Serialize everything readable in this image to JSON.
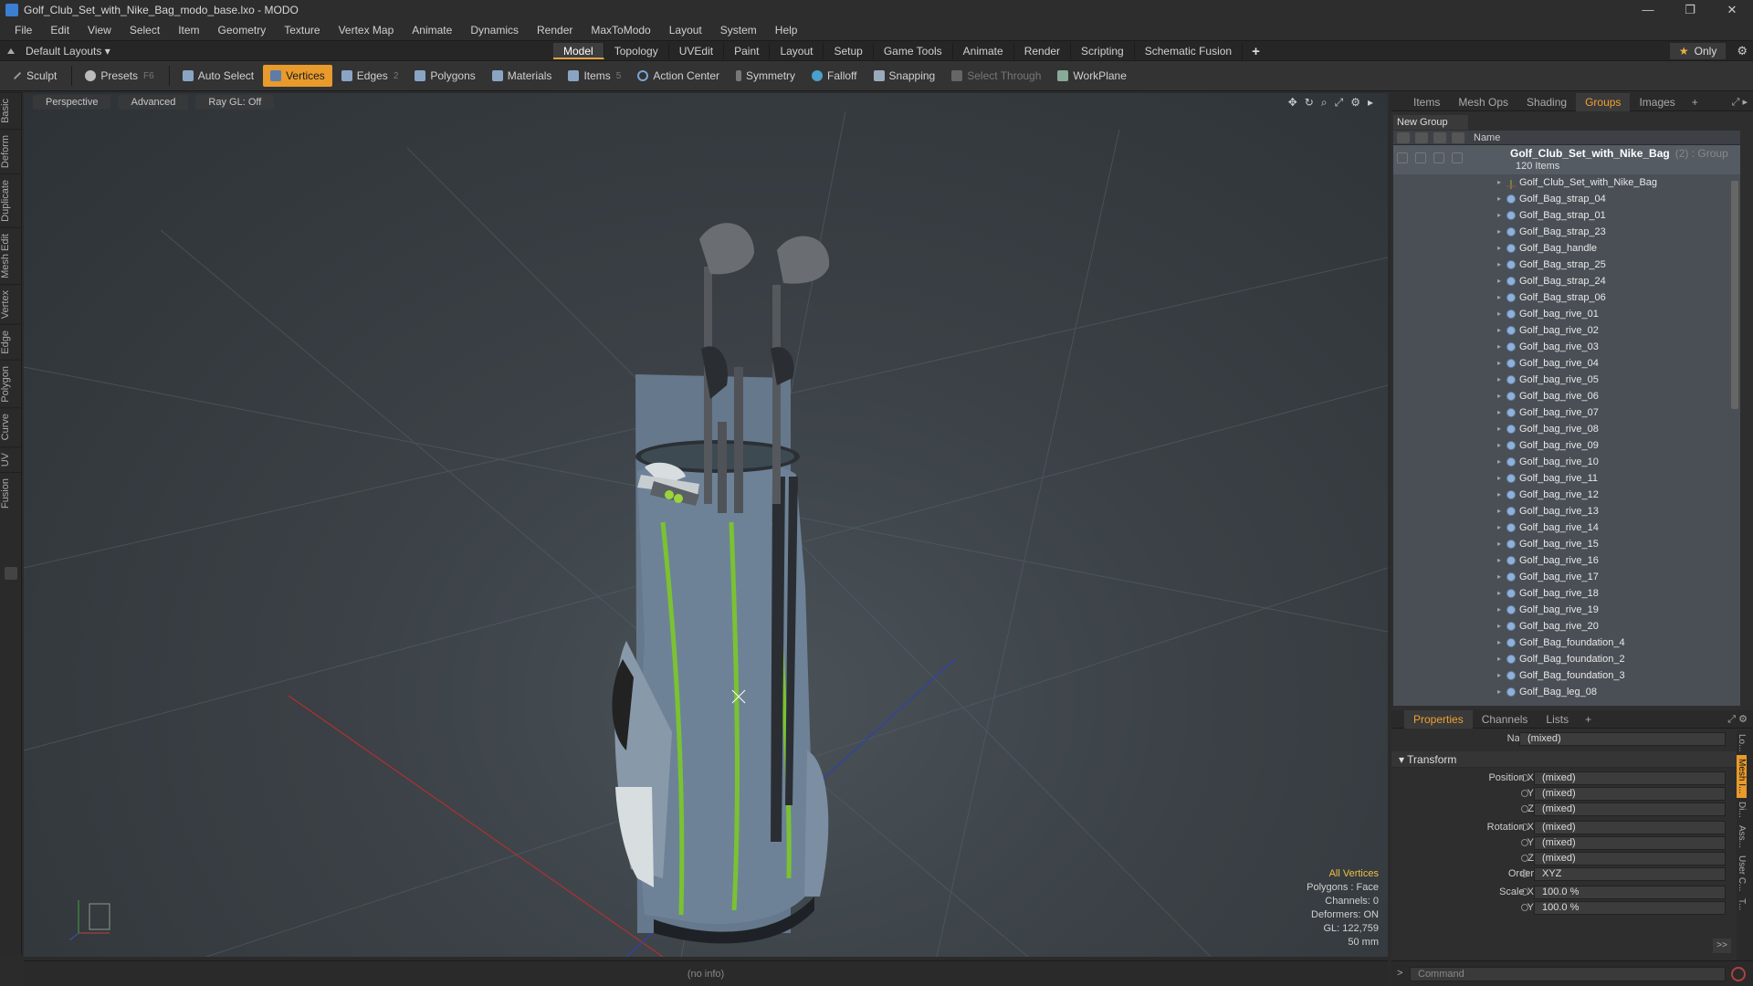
{
  "window": {
    "title": "Golf_Club_Set_with_Nike_Bag_modo_base.lxo - MODO",
    "controls": [
      "—",
      "❐",
      "✕"
    ]
  },
  "menu": [
    "File",
    "Edit",
    "View",
    "Select",
    "Item",
    "Geometry",
    "Texture",
    "Vertex Map",
    "Animate",
    "Dynamics",
    "Render",
    "MaxToModo",
    "Layout",
    "System",
    "Help"
  ],
  "layoutbar": {
    "layout_select": "Default Layouts ▾",
    "tabs": [
      "Model",
      "Topology",
      "UVEdit",
      "Paint",
      "Layout",
      "Setup",
      "Game Tools",
      "Animate",
      "Render",
      "Scripting",
      "Schematic Fusion"
    ],
    "active_tab": "Model",
    "add": "+",
    "only_label": "Only",
    "star": "★",
    "gear": "⚙"
  },
  "toolbar": {
    "sculpt": "Sculpt",
    "presets": "Presets",
    "presets_key": "F6",
    "auto_select": "Auto Select",
    "vertices": "Vertices",
    "edges": "Edges",
    "edges_key": "2",
    "polygons": "Polygons",
    "materials": "Materials",
    "items": "Items",
    "items_key": "5",
    "action_center": "Action Center",
    "symmetry": "Symmetry",
    "falloff": "Falloff",
    "snapping": "Snapping",
    "select_through": "Select Through",
    "workplane": "WorkPlane"
  },
  "left_tabs": [
    "Basic",
    "Deform",
    "Duplicate",
    "Mesh Edit",
    "Vertex",
    "Edge",
    "Polygon",
    "Curve",
    "UV",
    "Fusion"
  ],
  "viewport": {
    "buttons": [
      "Perspective",
      "Advanced",
      "Ray GL: Off"
    ],
    "info": {
      "all_vertices": "All Vertices",
      "polygons": "Polygons : Face",
      "channels": "Channels: 0",
      "deformers": "Deformers: ON",
      "gl": "GL: 122,759",
      "scale": "50 mm"
    }
  },
  "status": {
    "text": "(no info)"
  },
  "panel_tabs": [
    "Items",
    "Mesh Ops",
    "Shading",
    "Groups",
    "Images"
  ],
  "panel_active_tab": "Groups",
  "groups": {
    "new_group": "New Group",
    "name_header": "Name",
    "group_name": "Golf_Club_Set_with_Nike_Bag",
    "group_suffix": "(2) : Group",
    "group_count": "120 Items",
    "items": [
      "Golf_Club_Set_with_Nike_Bag",
      "Golf_Bag_strap_04",
      "Golf_Bag_strap_01",
      "Golf_Bag_strap_23",
      "Golf_Bag_handle",
      "Golf_Bag_strap_25",
      "Golf_Bag_strap_24",
      "Golf_Bag_strap_06",
      "Golf_bag_rive_01",
      "Golf_bag_rive_02",
      "Golf_bag_rive_03",
      "Golf_bag_rive_04",
      "Golf_bag_rive_05",
      "Golf_bag_rive_06",
      "Golf_bag_rive_07",
      "Golf_bag_rive_08",
      "Golf_bag_rive_09",
      "Golf_bag_rive_10",
      "Golf_bag_rive_11",
      "Golf_bag_rive_12",
      "Golf_bag_rive_13",
      "Golf_bag_rive_14",
      "Golf_bag_rive_15",
      "Golf_bag_rive_16",
      "Golf_bag_rive_17",
      "Golf_bag_rive_18",
      "Golf_bag_rive_19",
      "Golf_bag_rive_20",
      "Golf_Bag_foundation_4",
      "Golf_Bag_foundation_2",
      "Golf_Bag_foundation_3",
      "Golf_Bag_leg_08"
    ]
  },
  "props_tabs": [
    "Properties",
    "Channels",
    "Lists"
  ],
  "props_active_tab": "Properties",
  "properties": {
    "name_label": "Name",
    "name_value": "(mixed)",
    "transform_label": "Transform",
    "position_x_label": "Position X",
    "y_label": "Y",
    "z_label": "Z",
    "rotation_x_label": "Rotation X",
    "order_label": "Order",
    "scale_x_label": "Scale X",
    "mixed": "(mixed)",
    "order_value": "XYZ",
    "scale_value": "100.0 %",
    "more": ">>"
  },
  "props_side_tabs": [
    "Lo...",
    "Mesh I...",
    "Di...",
    "Ass...",
    "User C...",
    "T..."
  ],
  "command": {
    "placeholder": "Command",
    "prompt": ">"
  },
  "colors": {
    "accent": "#e89a2c",
    "panel": "#2e2e2e",
    "viewport": "#3b4146",
    "bag": "#6f8196",
    "trim": "#7ac232"
  }
}
